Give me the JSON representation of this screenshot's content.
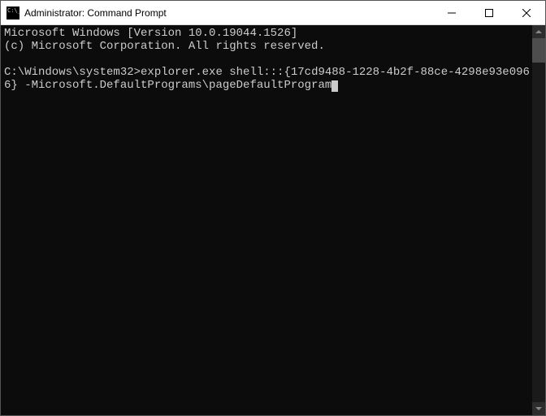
{
  "titlebar": {
    "title": "Administrator: Command Prompt"
  },
  "console": {
    "line1": "Microsoft Windows [Version 10.0.19044.1526]",
    "line2": "(c) Microsoft Corporation. All rights reserved.",
    "blank": "",
    "prompt": "C:\\Windows\\system32>",
    "command": "explorer.exe shell:::{17cd9488-1228-4b2f-88ce-4298e93e0966} -Microsoft.DefaultPrograms\\pageDefaultProgram"
  }
}
